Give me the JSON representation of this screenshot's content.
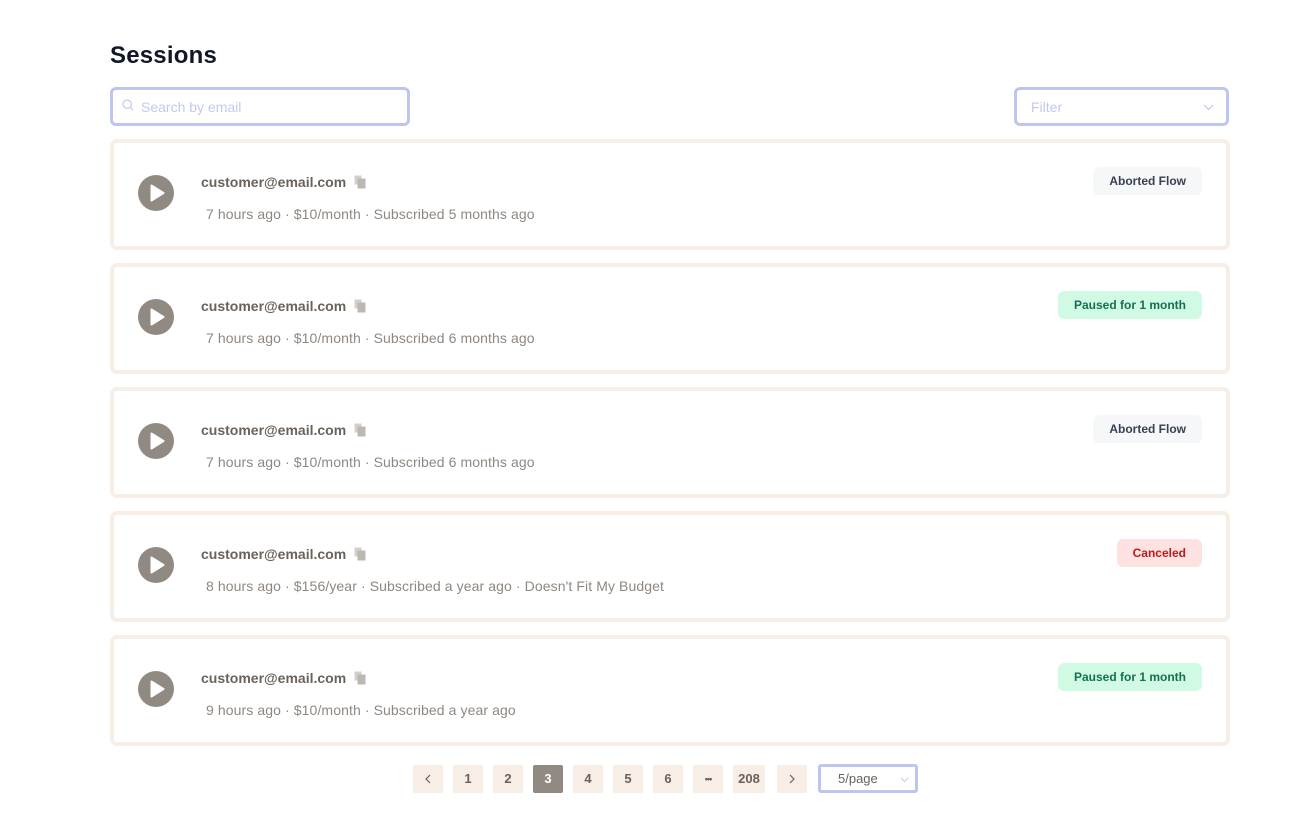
{
  "page": {
    "title": "Sessions"
  },
  "search": {
    "placeholder": "Search by email",
    "value": ""
  },
  "filter": {
    "placeholder": "Filter"
  },
  "sessions": [
    {
      "email": "customer@email.com",
      "meta": "7 hours ago · $10/month · Subscribed 5 months ago",
      "status": "Aborted Flow",
      "status_type": "aborted"
    },
    {
      "email": "customer@email.com",
      "meta": "7 hours ago · $10/month · Subscribed 6 months ago",
      "status": "Paused for 1 month",
      "status_type": "paused"
    },
    {
      "email": "customer@email.com",
      "meta": "7 hours ago · $10/month · Subscribed 6 months ago",
      "status": "Aborted Flow",
      "status_type": "aborted"
    },
    {
      "email": "customer@email.com",
      "meta": "8 hours ago · $156/year · Subscribed a year ago · Doesn't Fit My Budget",
      "status": "Canceled",
      "status_type": "canceled"
    },
    {
      "email": "customer@email.com",
      "meta": "9 hours ago · $10/month · Subscribed a year ago",
      "status": "Paused for 1 month",
      "status_type": "paused"
    }
  ],
  "pagination": {
    "prev": "‹",
    "next": "›",
    "pages": [
      "1",
      "2",
      "3",
      "4",
      "5",
      "6",
      "•••",
      "208"
    ],
    "current": "3",
    "page_size": "5/page"
  },
  "colors": {
    "accent": "#918a82",
    "card_border": "#f7eee5",
    "input_border": "#bcc6ef",
    "aborted_bg": "#f6f7f9",
    "paused_bg": "#d1fae5",
    "canceled_bg": "#fee2e2"
  }
}
